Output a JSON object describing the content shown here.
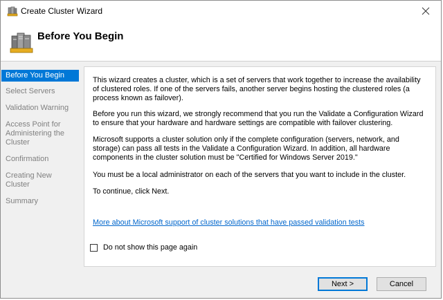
{
  "window": {
    "title": "Create Cluster Wizard"
  },
  "header": {
    "title": "Before You Begin"
  },
  "nav": {
    "items": [
      {
        "label": "Before You Begin",
        "active": true
      },
      {
        "label": "Select Servers",
        "active": false
      },
      {
        "label": "Validation Warning",
        "active": false
      },
      {
        "label": "Access Point for Administering the Cluster",
        "active": false
      },
      {
        "label": "Confirmation",
        "active": false
      },
      {
        "label": "Creating New Cluster",
        "active": false
      },
      {
        "label": "Summary",
        "active": false
      }
    ]
  },
  "content": {
    "paragraphs": [
      "This wizard creates a cluster, which is a set of servers that work together to increase the availability of clustered roles. If one of the servers fails, another server begins hosting the clustered roles (a process known as failover).",
      "Before you run this wizard, we strongly recommend that you run the Validate a Configuration Wizard to ensure that your hardware and hardware settings are compatible with failover clustering.",
      "Microsoft supports a cluster solution only if the complete configuration (servers, network, and storage) can pass all tests in the Validate a Configuration Wizard. In addition, all hardware components in the cluster solution must be \"Certified for Windows Server 2019.\"",
      "You must be a local administrator on each of the servers that you want to include in the cluster.",
      "To continue, click Next."
    ],
    "link": "More about Microsoft support of cluster solutions that have passed validation tests",
    "checkbox_label": "Do not show this page again",
    "checkbox_checked": false
  },
  "buttons": {
    "next": "Next >",
    "cancel": "Cancel"
  },
  "colors": {
    "accent": "#0078d7",
    "link": "#0066cc",
    "nav_inactive": "#808080"
  },
  "icons": {
    "app": "cluster-app-icon",
    "header": "cluster-servers-icon",
    "close": "close-icon"
  }
}
